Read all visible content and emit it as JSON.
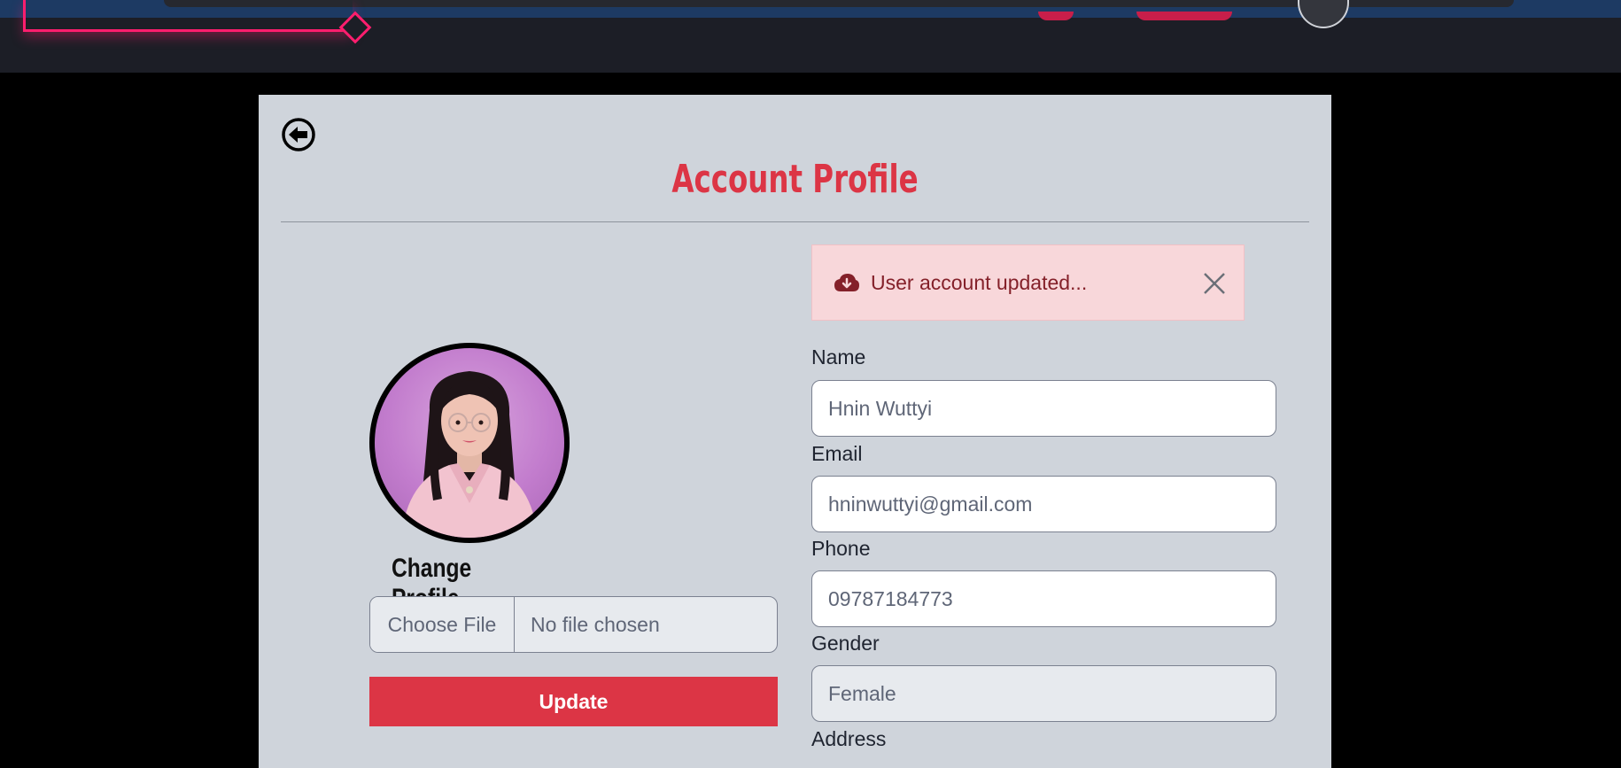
{
  "page": {
    "title": "Account Profile"
  },
  "profile": {
    "change_label": "Change Profile",
    "file_button": "Choose File",
    "file_status": "No file chosen",
    "update_label": "Update"
  },
  "alert": {
    "message": "User account updated...",
    "icon": "cloud-download-icon"
  },
  "form": {
    "name": {
      "label": "Name",
      "value": "Hnin Wuttyi"
    },
    "email": {
      "label": "Email",
      "value": "hninwuttyi@gmail.com"
    },
    "phone": {
      "label": "Phone",
      "value": "09787184773"
    },
    "gender": {
      "label": "Gender",
      "value": "Female"
    },
    "address": {
      "label": "Address"
    }
  },
  "colors": {
    "accent": "#dc3545",
    "card_bg": "#cfd4db",
    "alert_bg": "#f8d7da",
    "alert_text": "#842029",
    "nav_bg": "#1c1e26",
    "neon": "#ff1e6e"
  }
}
